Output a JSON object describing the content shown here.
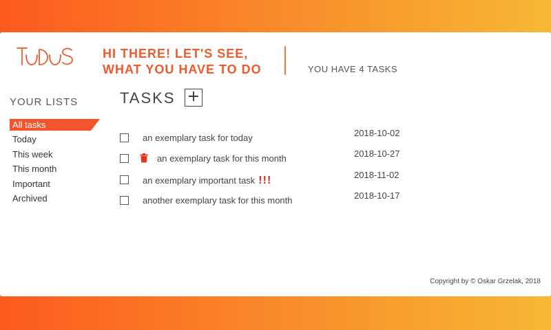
{
  "logo": {
    "text": "TODOS",
    "color": "#ee5a2d"
  },
  "header": {
    "greeting_line1": "HI THERE! LET'S SEE,",
    "greeting_line2": "WHAT YOU HAVE TO DO",
    "task_count": "YOU HAVE 4 TASKS"
  },
  "sidebar": {
    "heading": "YOUR LISTS",
    "items": [
      {
        "label": "All tasks",
        "active": true
      },
      {
        "label": "Today"
      },
      {
        "label": "This week"
      },
      {
        "label": "This month"
      },
      {
        "label": "Important"
      },
      {
        "label": "Archived"
      }
    ]
  },
  "main": {
    "title": "TASKS",
    "add_label": "+",
    "tasks": [
      {
        "text": "an exemplary task for today",
        "date": "2018-10-02",
        "checked": false
      },
      {
        "text": "an exemplary task for this month",
        "date": "2018-10-27",
        "checked": false,
        "hover_icon": "trash-icon"
      },
      {
        "text": "an exemplary important task",
        "importance": "!!!",
        "date": "2018-11-02",
        "checked": false
      },
      {
        "text": "another exemplary task for this month",
        "date": "2018-10-17",
        "checked": false
      }
    ]
  },
  "footer": {
    "copyright": "Copyright by © Oskar Grzelak, 2018"
  },
  "colors": {
    "accent": "#ee5a2d",
    "gradient_start": "#fd5a1e",
    "gradient_end": "#f7b835",
    "trash": "#e8321c",
    "important": "#e6261f"
  }
}
